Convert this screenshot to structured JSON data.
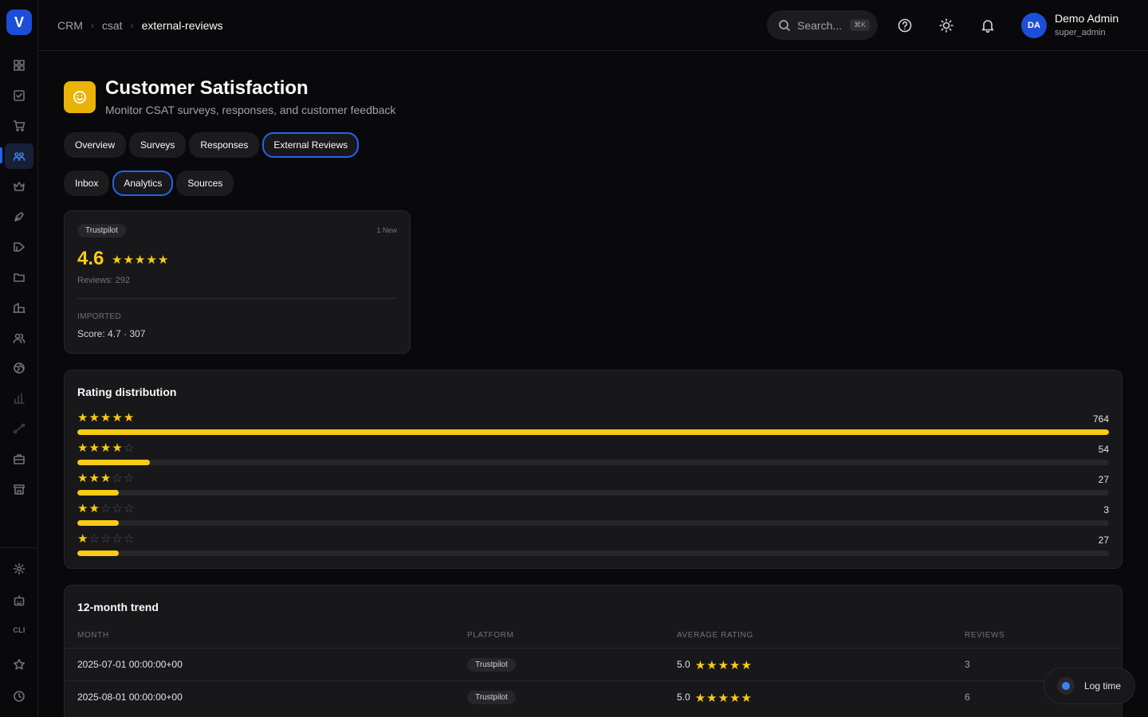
{
  "app": {
    "logo_letter": "V"
  },
  "sidebar": {
    "items": [
      {
        "icon": "grid-icon"
      },
      {
        "icon": "checkbox-icon"
      },
      {
        "icon": "cart-icon"
      },
      {
        "icon": "users-icon",
        "active": true
      },
      {
        "icon": "crown-icon"
      },
      {
        "icon": "pen-icon"
      },
      {
        "icon": "megaphone-icon"
      },
      {
        "icon": "folder-icon"
      },
      {
        "icon": "building-icon"
      },
      {
        "icon": "team-icon"
      },
      {
        "icon": "globe-icon"
      },
      {
        "icon": "bar-chart-icon"
      },
      {
        "icon": "route-icon"
      },
      {
        "icon": "briefcase-icon"
      },
      {
        "icon": "store-icon"
      }
    ],
    "bottom": [
      {
        "icon": "settings-icon"
      },
      {
        "icon": "bot-icon"
      },
      {
        "label": "CLI"
      },
      {
        "icon": "star-icon"
      },
      {
        "icon": "clock-icon"
      }
    ],
    "cli_label": "CLI"
  },
  "header": {
    "breadcrumb": [
      "CRM",
      "csat",
      "external-reviews"
    ],
    "search_placeholder": "Search...",
    "search_shortcut": "⌘K",
    "user": {
      "initials": "DA",
      "name": "Demo Admin",
      "role": "super_admin"
    }
  },
  "page": {
    "title": "Customer Satisfaction",
    "subtitle": "Monitor CSAT surveys, responses, and customer feedback",
    "tabs": [
      "Overview",
      "Surveys",
      "Responses",
      "External Reviews"
    ],
    "active_tab": "External Reviews",
    "subtabs": [
      "Inbox",
      "Analytics",
      "Sources"
    ],
    "active_subtab": "Analytics"
  },
  "source_card": {
    "platform": "Trustpilot",
    "new_label": "1 New",
    "score": "4.6",
    "stars": 5,
    "reviews_text": "Reviews: 292",
    "imported_label": "IMPORTED",
    "imported_value": "Score: 4.7 · 307"
  },
  "distribution": {
    "title": "Rating distribution",
    "rows": [
      {
        "stars": 5,
        "count": "764",
        "fraction": 1.0
      },
      {
        "stars": 4,
        "count": "54",
        "fraction": 0.07
      },
      {
        "stars": 3,
        "count": "27",
        "fraction": 0.04
      },
      {
        "stars": 2,
        "count": "3",
        "fraction": 0.04
      },
      {
        "stars": 1,
        "count": "27",
        "fraction": 0.04
      }
    ]
  },
  "trend": {
    "title": "12-month trend",
    "columns": [
      "MONTH",
      "PLATFORM",
      "AVERAGE RATING",
      "REVIEWS"
    ],
    "rows": [
      {
        "month": "2025-07-01 00:00:00+00",
        "platform": "Trustpilot",
        "rating": "5.0",
        "stars": 5,
        "reviews": "3"
      },
      {
        "month": "2025-08-01 00:00:00+00",
        "platform": "Trustpilot",
        "rating": "5.0",
        "stars": 5,
        "reviews": "6"
      }
    ]
  },
  "log_time": {
    "label": "Log time"
  },
  "colors": {
    "accent": "#2563eb",
    "star": "#facc15",
    "brand_icon": "#eab308"
  }
}
